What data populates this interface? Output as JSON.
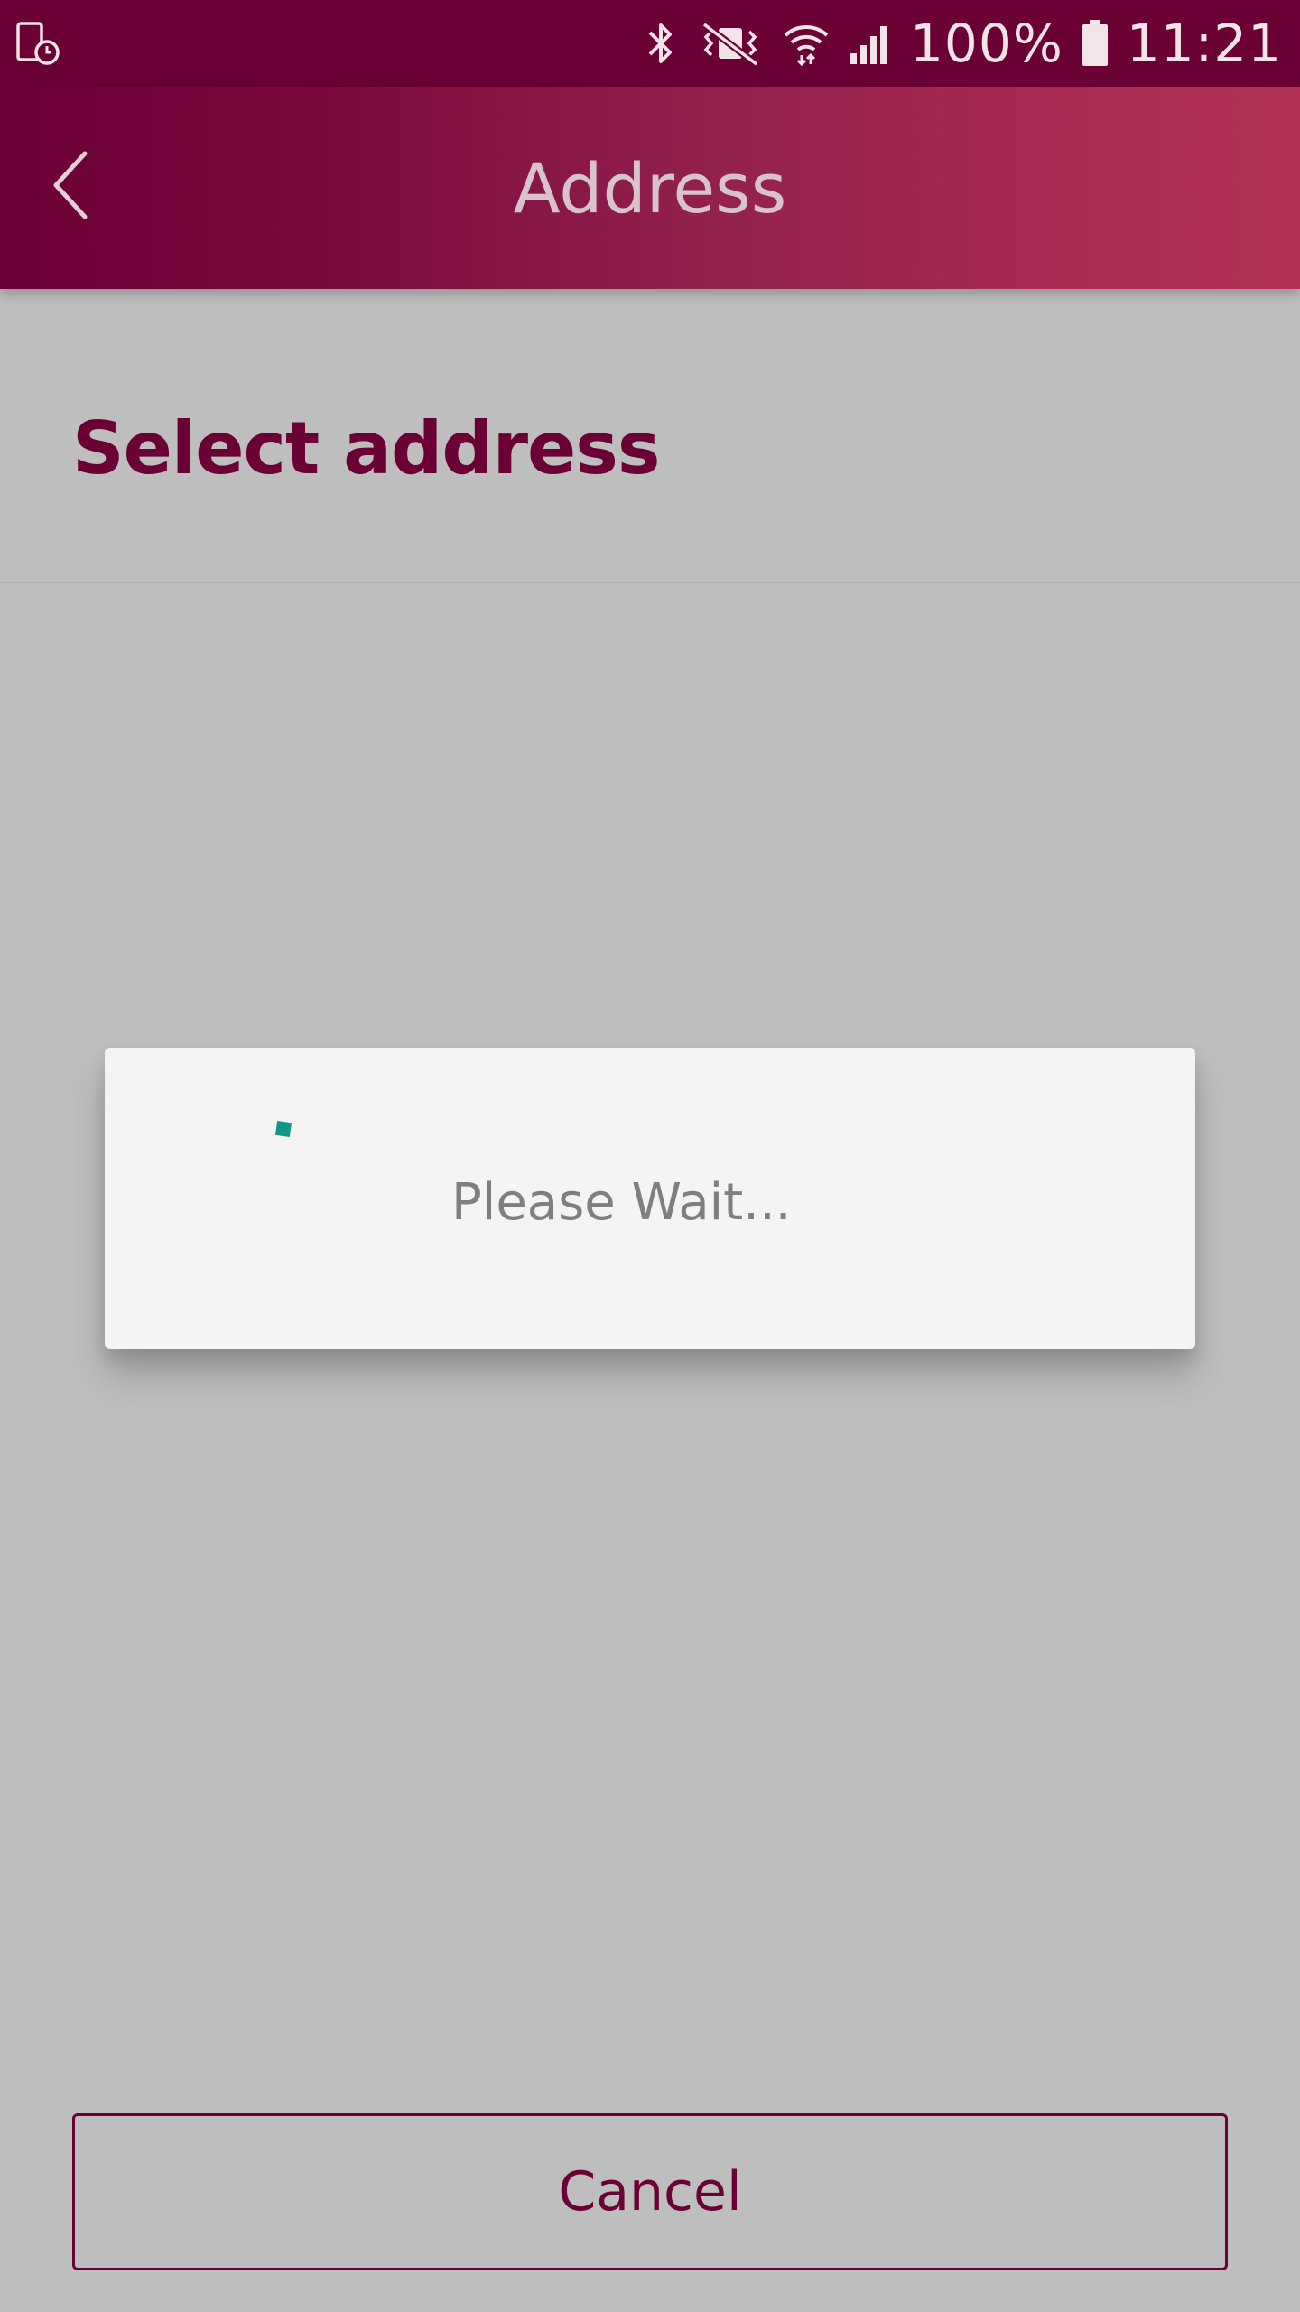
{
  "status_bar": {
    "left_icon": "device-clock-icon",
    "icons": [
      "bluetooth-icon",
      "vibrate-off-icon",
      "wifi-icon",
      "signal-icon"
    ],
    "battery_percent": "100%",
    "battery_icon": "battery-icon",
    "time": "11:21"
  },
  "app_bar": {
    "back_icon": "chevron-left-icon",
    "title": "Address"
  },
  "section": {
    "title": "Select address"
  },
  "dialog": {
    "spinner_icon": "progress-spinner-icon",
    "message": "Please Wait..."
  },
  "footer": {
    "cancel_label": "Cancel"
  },
  "colors": {
    "brand": "#6b0035",
    "brand_light": "#b03153",
    "accent_teal": "#139688",
    "overlay_background": "#bebebe",
    "dialog_background": "#f4f4f4"
  }
}
